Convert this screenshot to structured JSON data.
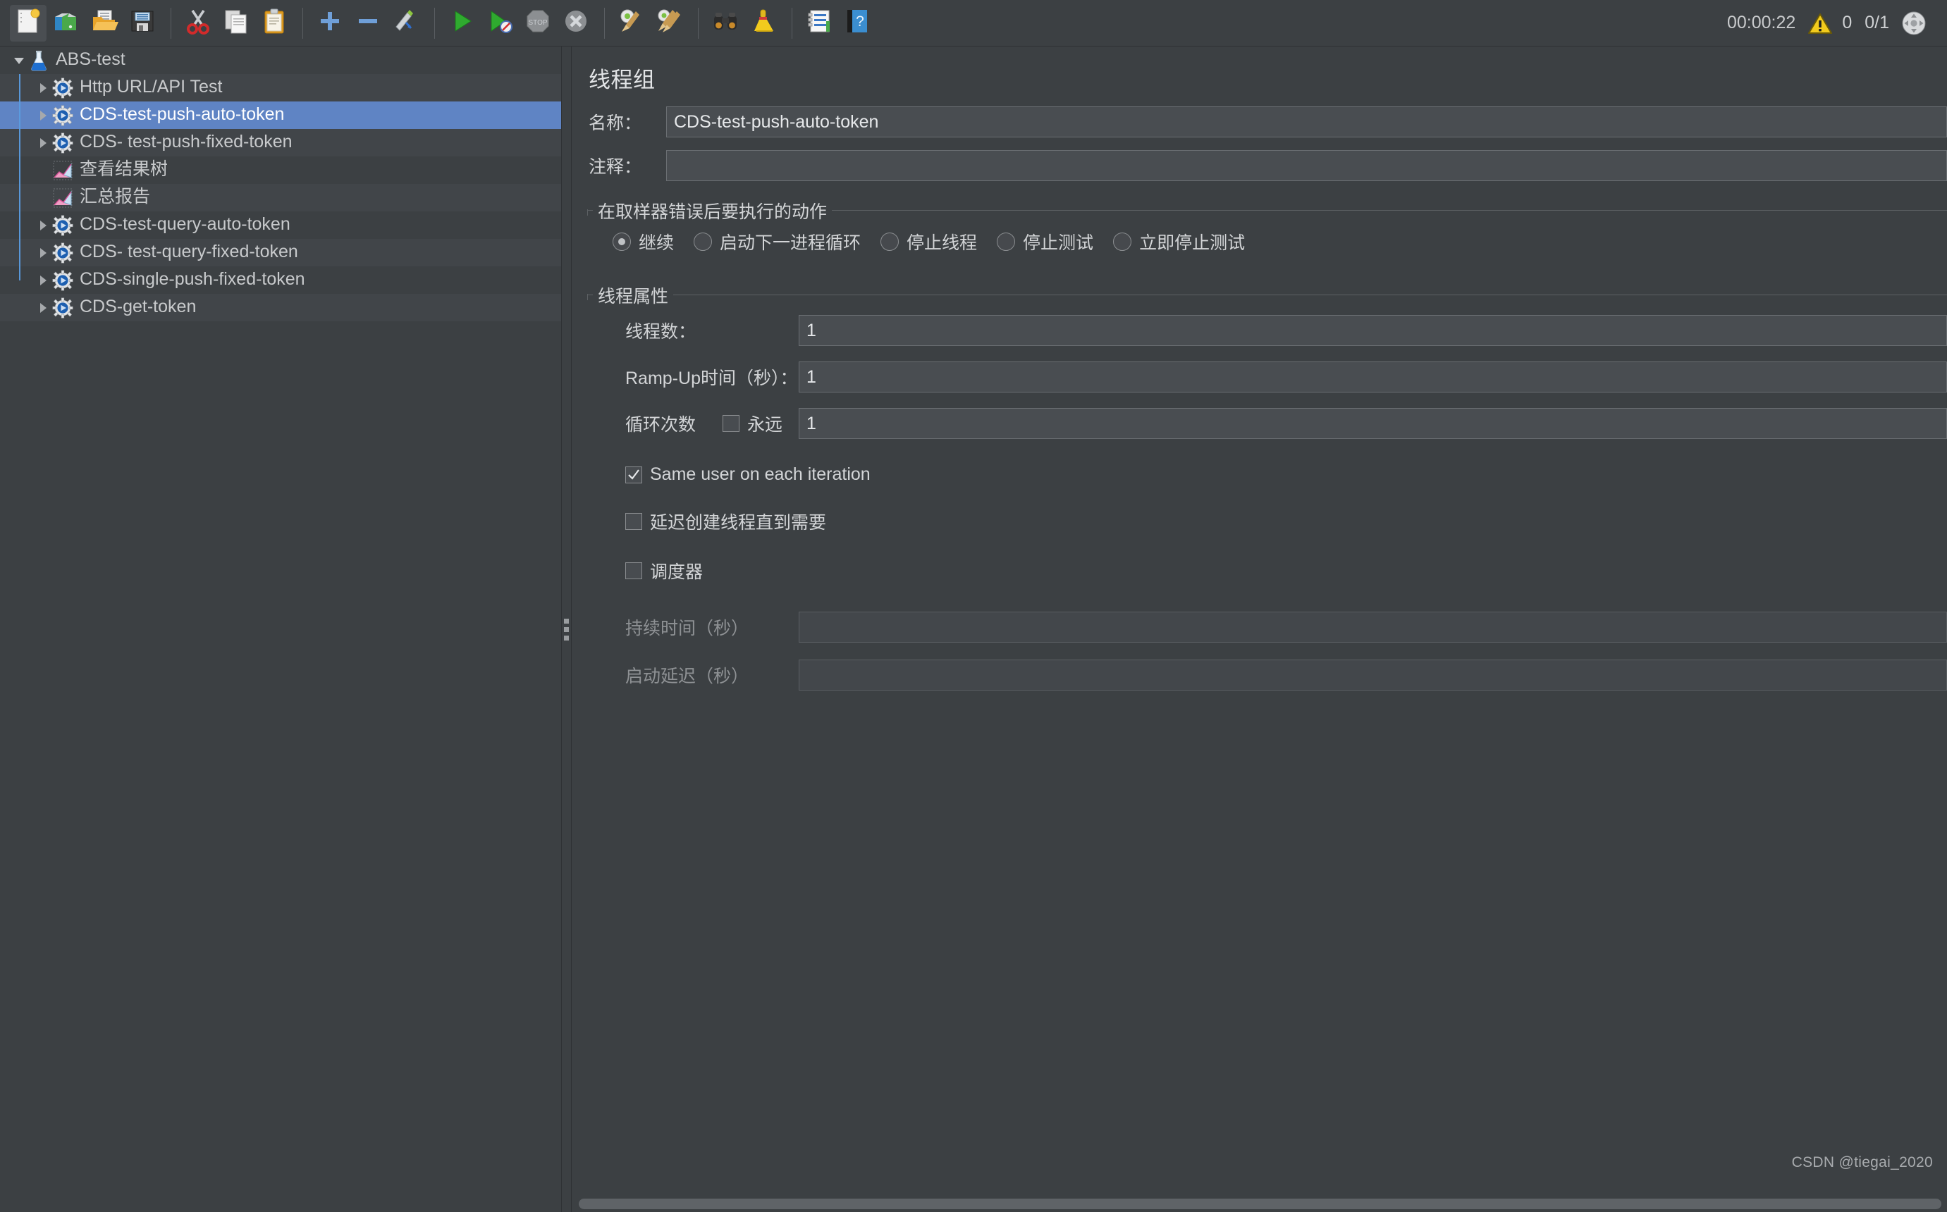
{
  "toolbar": {
    "buttons": [
      {
        "name": "new-test-plan",
        "icon": "new-document-icon",
        "active": true
      },
      {
        "name": "open-templates",
        "icon": "templates-icon",
        "active": false
      },
      {
        "name": "open-file",
        "icon": "open-folder-icon",
        "active": false
      },
      {
        "name": "save-test-plan",
        "icon": "save-floppy-icon",
        "active": false
      },
      {
        "name": "cut",
        "icon": "scissors-icon",
        "active": false
      },
      {
        "name": "copy",
        "icon": "copy-pages-icon",
        "active": false
      },
      {
        "name": "paste",
        "icon": "clipboard-icon",
        "active": false
      },
      {
        "name": "expand-all",
        "icon": "plus-icon",
        "active": false
      },
      {
        "name": "collapse-all",
        "icon": "minus-icon",
        "active": false
      },
      {
        "name": "toggle-enabled",
        "icon": "pencil-toggle-icon",
        "active": false
      },
      {
        "name": "start",
        "icon": "green-play-icon",
        "active": false
      },
      {
        "name": "start-no-timers",
        "icon": "play-no-timers-icon",
        "active": false
      },
      {
        "name": "stop",
        "icon": "stop-sign-icon",
        "active": false
      },
      {
        "name": "shutdown",
        "icon": "shutdown-x-icon",
        "active": false
      },
      {
        "name": "clear",
        "icon": "gear-broom-icon",
        "active": false
      },
      {
        "name": "clear-all",
        "icon": "gear-double-broom-icon",
        "active": false
      },
      {
        "name": "search",
        "icon": "binoculars-icon",
        "active": false
      },
      {
        "name": "reset-search",
        "icon": "yellow-broom-icon",
        "active": false
      },
      {
        "name": "function-helper",
        "icon": "list-notes-icon",
        "active": false
      },
      {
        "name": "help",
        "icon": "help-book-icon",
        "active": false
      }
    ],
    "status": {
      "elapsed": "00:00:22",
      "warning_icon": "warning-triangle-icon",
      "warning_count": "0",
      "threads": "0/1",
      "expand_icon": "expand-arrows-icon"
    }
  },
  "tree": {
    "items": [
      {
        "label": "ABS-test",
        "icon": "flask-icon",
        "indent": 0,
        "twisty": "down",
        "selected": false,
        "alt": false
      },
      {
        "label": "Http URL/API Test",
        "icon": "thread-group-icon",
        "indent": 1,
        "twisty": "right",
        "selected": false,
        "alt": true
      },
      {
        "label": "CDS-test-push-auto-token",
        "icon": "thread-group-icon",
        "indent": 1,
        "twisty": "right",
        "selected": true,
        "alt": false
      },
      {
        "label": "CDS- test-push-fixed-token",
        "icon": "thread-group-icon",
        "indent": 1,
        "twisty": "right",
        "selected": false,
        "alt": true
      },
      {
        "label": "查看结果树",
        "icon": "view-results-tree-icon",
        "indent": 1,
        "twisty": "none",
        "selected": false,
        "alt": false
      },
      {
        "label": "汇总报告",
        "icon": "summary-report-icon",
        "indent": 1,
        "twisty": "none",
        "selected": false,
        "alt": true
      },
      {
        "label": "CDS-test-query-auto-token",
        "icon": "thread-group-icon",
        "indent": 1,
        "twisty": "right",
        "selected": false,
        "alt": false
      },
      {
        "label": "CDS- test-query-fixed-token",
        "icon": "thread-group-icon",
        "indent": 1,
        "twisty": "right",
        "selected": false,
        "alt": true
      },
      {
        "label": "CDS-single-push-fixed-token",
        "icon": "thread-group-icon",
        "indent": 1,
        "twisty": "right",
        "selected": false,
        "alt": false
      },
      {
        "label": "CDS-get-token",
        "icon": "thread-group-icon",
        "indent": 1,
        "twisty": "right",
        "selected": false,
        "alt": true
      }
    ]
  },
  "panel": {
    "title": "线程组",
    "name_label": "名称：",
    "name_value": "CDS-test-push-auto-token",
    "comment_label": "注释：",
    "comment_value": "",
    "error_action": {
      "legend": "在取样器错误后要执行的动作",
      "options": [
        {
          "label": "继续",
          "selected": true
        },
        {
          "label": "启动下一进程循环",
          "selected": false
        },
        {
          "label": "停止线程",
          "selected": false
        },
        {
          "label": "停止测试",
          "selected": false
        },
        {
          "label": "立即停止测试",
          "selected": false
        }
      ]
    },
    "thread_props": {
      "legend": "线程属性",
      "num_threads_label": "线程数：",
      "num_threads_value": "1",
      "ramp_up_label": "Ramp-Up时间（秒）：",
      "ramp_up_value": "1",
      "loop_label": "循环次数",
      "forever_label": "永远",
      "forever_checked": false,
      "loop_value": "1",
      "same_user_label": "Same user on each iteration",
      "same_user_checked": true,
      "delayed_start_label": "延迟创建线程直到需要",
      "delayed_start_checked": false,
      "scheduler_label": "调度器",
      "scheduler_checked": false,
      "duration_label": "持续时间（秒）",
      "duration_value": "",
      "startup_delay_label": "启动延迟（秒）",
      "startup_delay_value": ""
    }
  },
  "watermark": "CSDN @tiegai_2020",
  "colors": {
    "background": "#3c4043",
    "row_alt": "#414549",
    "selection": "#5f84c4",
    "text": "#c8cacc",
    "field_bg": "#494d51",
    "field_border": "#6a6e72",
    "tree_connector": "#5a9ce0",
    "warning_yellow": "#f2cb1d"
  }
}
